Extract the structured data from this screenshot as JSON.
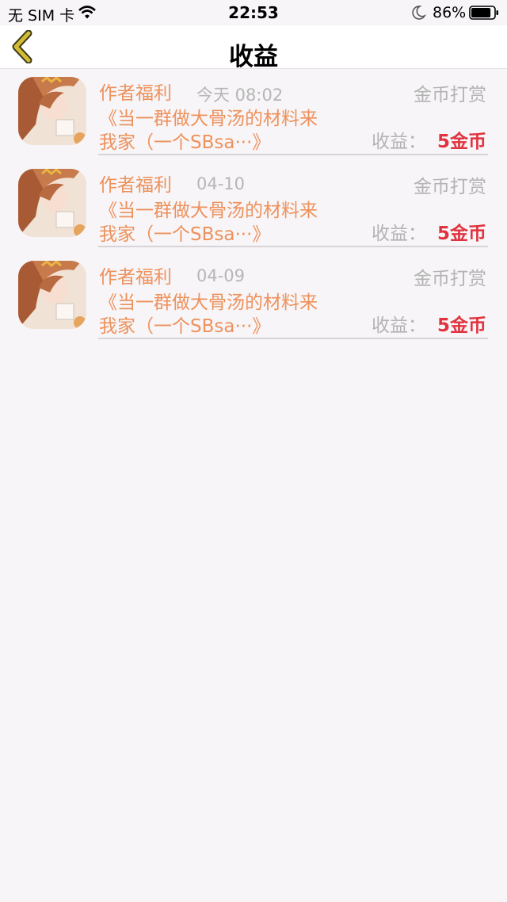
{
  "status_bar": {
    "carrier": "无 SIM 卡",
    "time": "22:53",
    "battery_percent": "86%",
    "battery_level": 0.86,
    "icons": [
      "wifi-icon",
      "moon-icon",
      "battery-icon"
    ]
  },
  "nav": {
    "title": "收益",
    "back_icon": "chevron-left-icon"
  },
  "colors": {
    "accent_orange": "#ee915c",
    "earn_red": "#e0333f",
    "muted_gray": "#b3b3b3",
    "back_chevron": "#c8ad2a"
  },
  "earnings": [
    {
      "title": "作者福利",
      "date": "今天 08:02",
      "type": "金币打赏",
      "desc_line1": "《当一群做大骨汤的材料来",
      "desc_line2": "我家（一个SBsa···》",
      "earn_label": "收益：",
      "earn_value": "5金币"
    },
    {
      "title": "作者福利",
      "date": "04-10",
      "type": "金币打赏",
      "desc_line1": "《当一群做大骨汤的材料来",
      "desc_line2": "我家（一个SBsa···》",
      "earn_label": "收益：",
      "earn_value": "5金币"
    },
    {
      "title": "作者福利",
      "date": "04-09",
      "type": "金币打赏",
      "desc_line1": "《当一群做大骨汤的材料来",
      "desc_line2": "我家（一个SBsa···》",
      "earn_label": "收益：",
      "earn_value": "5金币"
    }
  ]
}
